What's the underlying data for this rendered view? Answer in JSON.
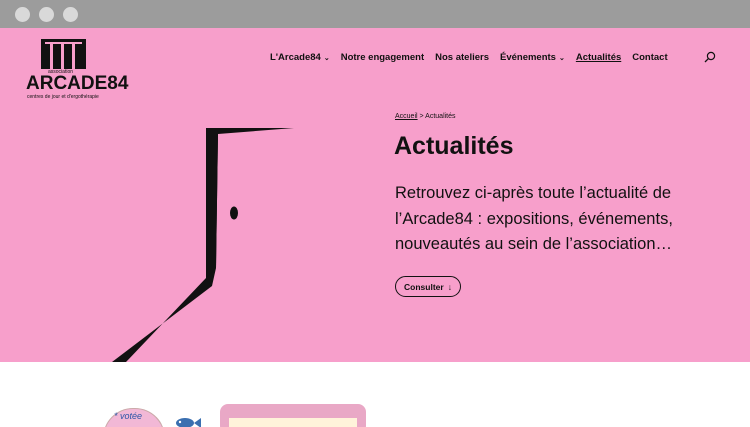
{
  "logo": {
    "small": "association",
    "name": "ARCADE84",
    "sub": "centres de jour et d'ergothérapie"
  },
  "nav": [
    {
      "label": "L'Arcade84",
      "dropdown": true
    },
    {
      "label": "Notre engagement",
      "dropdown": false
    },
    {
      "label": "Nos ateliers",
      "dropdown": false
    },
    {
      "label": "Événements",
      "dropdown": true
    },
    {
      "label": "Actualités",
      "dropdown": false,
      "active": true
    },
    {
      "label": "Contact",
      "dropdown": false
    }
  ],
  "breadcrumb": {
    "home": "Accueil",
    "sep": " > ",
    "current": "Actualités"
  },
  "hero": {
    "title": "Actualités",
    "lead": "Retrouvez ci-après toute l’actualité de l’Arcade84 : expositions, événements, nouveautés au sein de l’association…",
    "button": "Consulter",
    "button_arrow": "↓"
  },
  "lower": {
    "blob_text": "* votée"
  },
  "colors": {
    "hero_bg": "#f79fcb",
    "chrome": "#9c9c9c",
    "ink": "#111111"
  }
}
